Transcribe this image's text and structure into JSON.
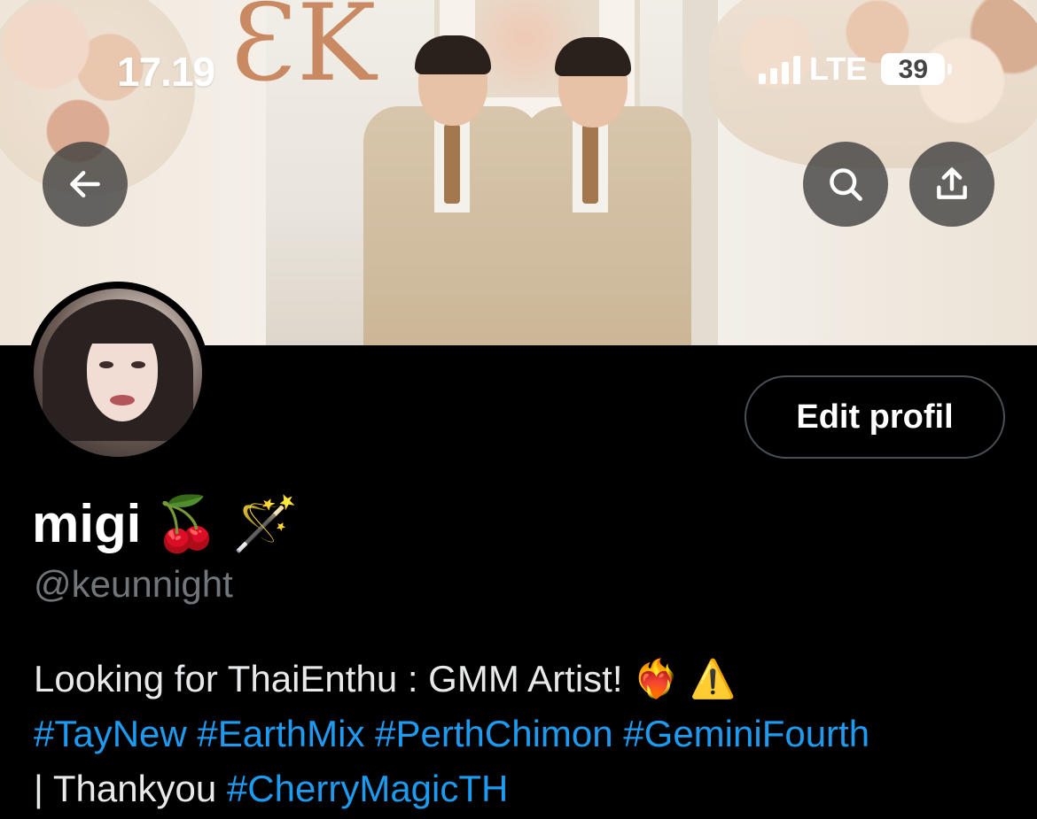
{
  "status_bar": {
    "time": "17.19",
    "network": "LTE",
    "battery": "39"
  },
  "header": {
    "back_icon": "arrow-left-icon",
    "search_icon": "search-icon",
    "share_icon": "share-upload-icon"
  },
  "profile": {
    "edit_button_label": "Edit profil",
    "display_name": "migi",
    "display_name_emojis": [
      "🍒",
      "🪄"
    ],
    "handle": "@keunnight",
    "bio": {
      "line1_text": "Looking for ThaiEnthu : GMM Artist!",
      "line1_emojis": [
        "❤️‍🔥",
        "⚠️"
      ],
      "line2_tags": [
        "#TayNew",
        "#EarthMix",
        "#PerthChimon",
        "#GeminiFourth"
      ],
      "line3_prefix": "| Thankyou",
      "line3_tag": "#CherryMagicTH"
    }
  },
  "colors": {
    "link": "#1d9bf0",
    "muted": "#71767b",
    "text": "#e7e9ea",
    "background": "#000000"
  }
}
